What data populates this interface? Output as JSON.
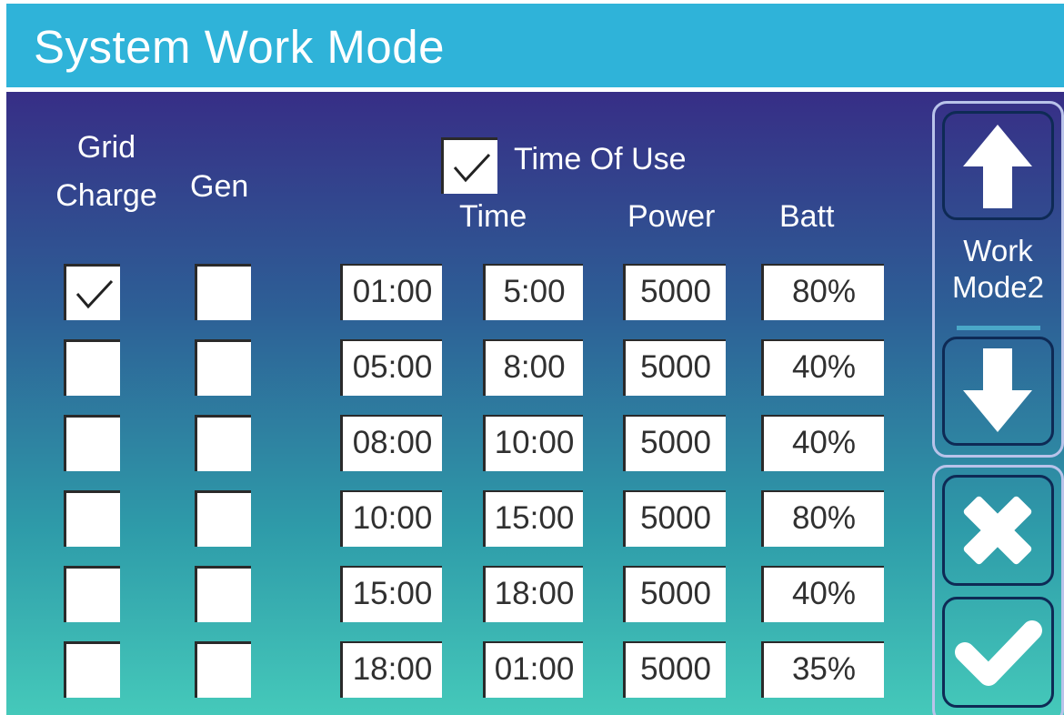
{
  "header": {
    "title": "System Work Mode"
  },
  "columns": {
    "grid_charge": "Grid\nCharge",
    "grid_line1": "Grid",
    "grid_line2": "Charge",
    "gen": "Gen",
    "time_of_use": "Time Of Use",
    "time": "Time",
    "power": "Power",
    "batt": "Batt"
  },
  "time_of_use_enabled": true,
  "rows": [
    {
      "grid_charge": true,
      "gen": false,
      "start": "01:00",
      "end": "5:00",
      "power": "5000",
      "batt": "80%"
    },
    {
      "grid_charge": false,
      "gen": false,
      "start": "05:00",
      "end": "8:00",
      "power": "5000",
      "batt": "40%"
    },
    {
      "grid_charge": false,
      "gen": false,
      "start": "08:00",
      "end": "10:00",
      "power": "5000",
      "batt": "40%"
    },
    {
      "grid_charge": false,
      "gen": false,
      "start": "10:00",
      "end": "15:00",
      "power": "5000",
      "batt": "80%"
    },
    {
      "grid_charge": false,
      "gen": false,
      "start": "15:00",
      "end": "18:00",
      "power": "5000",
      "batt": "40%"
    },
    {
      "grid_charge": false,
      "gen": false,
      "start": "18:00",
      "end": "01:00",
      "power": "5000",
      "batt": "35%"
    }
  ],
  "side": {
    "mode_line1": "Work",
    "mode_line2": "Mode2",
    "icons": [
      "arrow-up-icon",
      "arrow-down-icon",
      "close-icon",
      "check-icon"
    ]
  },
  "colors": {
    "header": "#2fb3d9",
    "gradient_top": "#372e86",
    "gradient_bottom": "#45c9ba",
    "cell_bg": "#ffffff",
    "cell_text": "#303030"
  }
}
